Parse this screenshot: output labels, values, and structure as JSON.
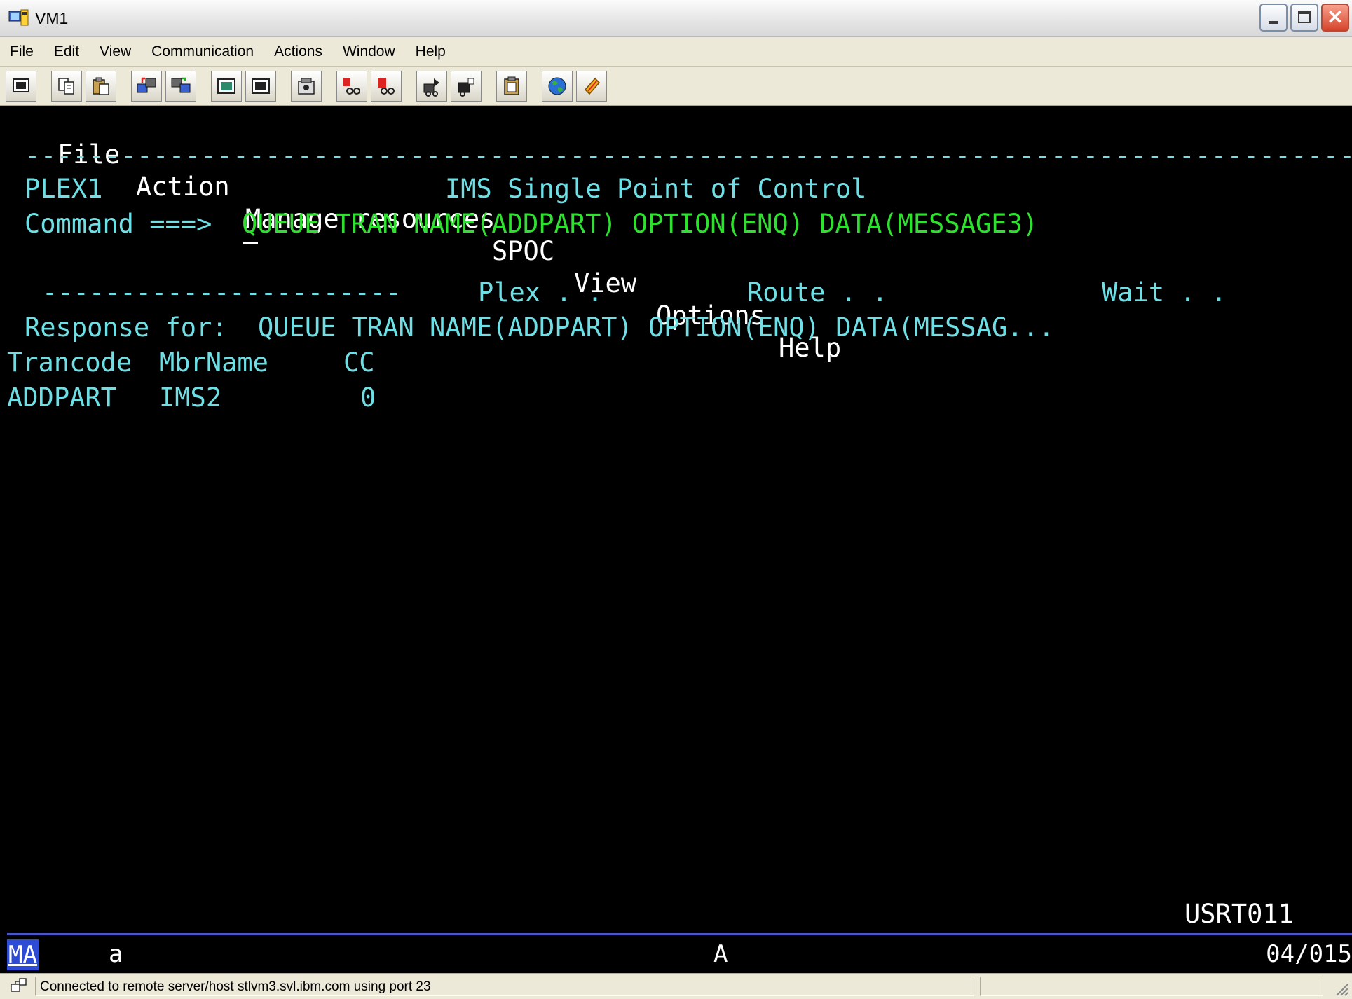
{
  "window": {
    "title": "VM1"
  },
  "menubar": {
    "items": [
      {
        "label": "File"
      },
      {
        "label": "Edit"
      },
      {
        "label": "View"
      },
      {
        "label": "Communication"
      },
      {
        "label": "Actions"
      },
      {
        "label": "Window"
      },
      {
        "label": "Help"
      }
    ]
  },
  "toolbar": {
    "icons": [
      "print-screen-icon",
      "copy-icon",
      "paste-icon",
      "send-file-icon",
      "receive-file-icon",
      "display-keypad-icon",
      "macro-icon",
      "record-macro-icon",
      "stop-macro-icon",
      "play-macro-icon",
      "disconnect-icon",
      "connect-icon",
      "clipboard-icon",
      "web-globe-icon",
      "map-key-icon"
    ]
  },
  "terminal": {
    "actionbar": [
      "File",
      "Action",
      "Manage resources",
      "SPOC",
      "View",
      "Options",
      "Help"
    ],
    "separator": "------------------------------------------------------------------------------------",
    "plex_name": "PLEX1",
    "screen_title": "IMS Single Point of Control",
    "command_label": "Command ===>",
    "command_value": "QUEUE TRAN NAME(ADDPART) OPTION(ENQ) DATA(MESSAGE3)",
    "params_dashes": "-----------------------",
    "plex_label": "Plex . .",
    "route_label": "Route . .",
    "wait_label": "Wait . .",
    "response_label": "Response for:",
    "response_command": "QUEUE TRAN NAME(ADDPART) OPTION(ENQ) DATA(MESSAG...",
    "table": {
      "headers": [
        "Trancode",
        "MbrName",
        "CC"
      ],
      "rows": [
        {
          "trancode": "ADDPART",
          "mbrname": "IMS2",
          "cc": "0"
        }
      ]
    },
    "user_id": "USRT011"
  },
  "oia": {
    "session_indicator": "MA",
    "session_char": "a",
    "session_id": "A",
    "cursor_position": "04/015"
  },
  "status": {
    "message": "Connected to remote server/host stlvm3.svl.ibm.com using port 23"
  }
}
